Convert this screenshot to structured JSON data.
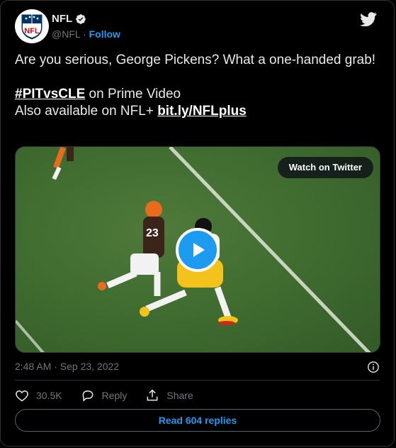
{
  "author": {
    "name": "NFL",
    "handle": "@NFL",
    "separator": "·",
    "follow_label": "Follow"
  },
  "icons": {
    "avatar": "nfl-shield-logo",
    "verified": "verified-badge-icon",
    "twitter": "twitter-bird-icon",
    "play": "play-icon",
    "info": "info-icon",
    "like": "heart-icon",
    "reply": "reply-bubble-icon",
    "share": "share-upload-icon"
  },
  "tweet": {
    "line1": "Are you serious, George Pickens? What a one-handed grab!",
    "hashtag": "#PITvsCLE",
    "hashtag_suffix": " on Prime Video",
    "line3_prefix": "Also available on NFL+ ",
    "link": "bit.ly/NFLplus"
  },
  "media": {
    "watch_label": "Watch on Twitter"
  },
  "timestamp": "2:48 AM · Sep 23, 2022",
  "actions": {
    "like_count": "30.5K",
    "reply_label": "Reply",
    "share_label": "Share"
  },
  "read_replies_label": "Read 604 replies",
  "colors": {
    "accent": "#1d9bf0",
    "background": "#000000",
    "text": "#e7e9ea",
    "muted": "#71767b",
    "border": "#2f3336"
  }
}
